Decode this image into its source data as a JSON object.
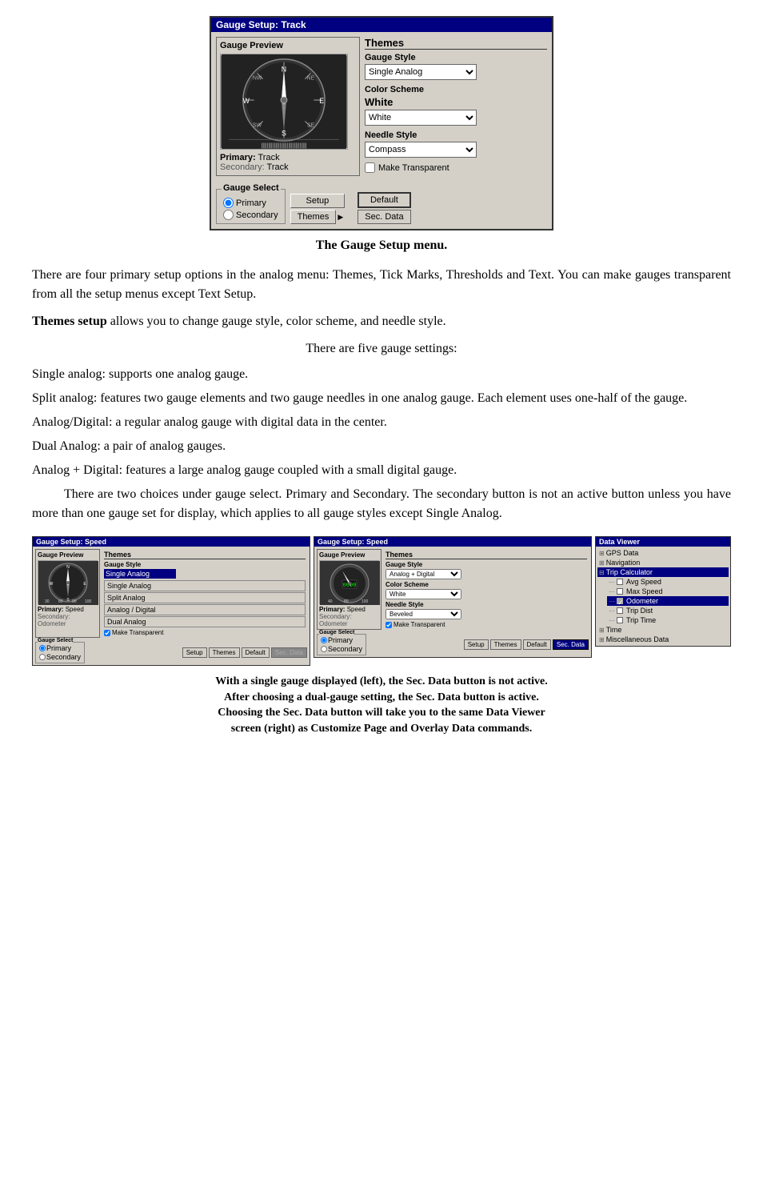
{
  "main_dialog": {
    "title": "Gauge Setup: Track",
    "gauge_preview": {
      "section_title": "Gauge Preview",
      "primary_label": "Primary:",
      "primary_value": "Track",
      "secondary_label": "Secondary:",
      "secondary_value": "Track"
    },
    "themes": {
      "section_title": "Themes",
      "gauge_style_label": "Gauge Style",
      "gauge_style_subtext": "",
      "gauge_style_selected": "Single Analog",
      "color_scheme_label": "Color Scheme",
      "color_scheme_value": "White",
      "needle_style_label": "Needle Style",
      "needle_style_selected": "Compass",
      "make_transparent_label": "Make Transparent"
    },
    "gauge_select": {
      "title": "Gauge Select",
      "primary_label": "Primary",
      "secondary_label": "Secondary",
      "default_btn": "Default",
      "setup_btn": "Setup",
      "themes_btn": "Themes",
      "sec_data_btn": "Sec. Data"
    }
  },
  "figure_caption": "The Gauge Setup menu.",
  "paragraphs": [
    "There are four primary setup options in the analog menu: Themes, Tick Marks, Thresholds and Text. You can make gauges transparent from all the setup menus except Text Setup.",
    "Themes setup allows you to change gauge style, color scheme, and needle style.",
    "There are five gauge settings:",
    "Single analog: supports one analog gauge.",
    "Split analog: features two gauge elements and two gauge needles in one analog gauge. Each element uses one-half of the gauge.",
    "Analog/Digital: a regular analog gauge with digital data in the center.",
    "Dual Analog: a pair of analog gauges.",
    "Analog + Digital: features a large analog gauge coupled with a small digital gauge.",
    "There are two choices under gauge select. Primary and Secondary. The secondary button is not an active button unless you have more than one gauge set for display, which applies to all gauge styles except Single Analog."
  ],
  "themes_setup_bold": "Themes setup",
  "small_dialogs": {
    "left": {
      "title": "Gauge Setup: Speed",
      "preview_title": "Gauge Preview",
      "themes_title": "Themes",
      "gauge_style_label": "Gauge Style",
      "selected_style": "Single Analog",
      "menu_items": [
        "Single Analog",
        "Split Analog",
        "Analog / Digital",
        "Dual Analog"
      ],
      "make_transparent": "Make Transparent",
      "primary_label": "Primary:",
      "primary_value": "Speed",
      "secondary_label": "Secondary:",
      "secondary_value": "Odometer",
      "gauge_select_title": "Gauge Select",
      "primary_radio": "Primary",
      "secondary_radio": "Secondary",
      "setup_btn": "Setup",
      "themes_btn": "Themes",
      "default_btn": "Default",
      "sec_data_btn": "Sec. Data"
    },
    "right": {
      "title": "Gauge Setup: Speed",
      "preview_title": "Gauge Preview",
      "themes_title": "Themes",
      "gauge_style_label": "Gauge Style",
      "selected_style": "Analog + Digital",
      "color_scheme_label": "Color Scheme",
      "color_scheme_value": "White",
      "needle_style_label": "Needle Style",
      "needle_style_value": "Beveled",
      "make_transparent": "Make Transparent",
      "primary_label": "Primary:",
      "primary_value": "Speed",
      "secondary_label": "Secondary:",
      "secondary_value": "Odometer",
      "gauge_select_title": "Gauge Select",
      "primary_radio": "Primary",
      "secondary_radio": "Secondary",
      "setup_btn": "Setup",
      "themes_btn": "Themes",
      "default_btn": "Default",
      "sec_data_btn": "Sec. Data"
    },
    "data_viewer": {
      "title": "Data Viewer",
      "items": [
        {
          "label": "GPS Data",
          "icon": "+",
          "indent": 0
        },
        {
          "label": "Navigation",
          "icon": "+",
          "indent": 0
        },
        {
          "label": "Trip Calculator",
          "icon": "-",
          "indent": 0,
          "selected": true
        },
        {
          "label": "Avg Speed",
          "icon": "□",
          "indent": 1
        },
        {
          "label": "Max Speed",
          "icon": "□",
          "indent": 1
        },
        {
          "label": "Odometer",
          "icon": "☑",
          "indent": 1,
          "selected": true
        },
        {
          "label": "Trip Dist",
          "icon": "□",
          "indent": 1
        },
        {
          "label": "Trip Time",
          "icon": "□",
          "indent": 1
        },
        {
          "label": "Time",
          "icon": "+",
          "indent": 0
        },
        {
          "label": "Miscellaneous Data",
          "icon": "+",
          "indent": 0
        }
      ]
    }
  },
  "bottom_caption": {
    "line1": "With a single gauge displayed (left), the Sec. Data button is not active.",
    "line2": "After choosing a dual-gauge setting, the Sec. Data button is active.",
    "line3": "Choosing the Sec. Data button will take you to the same Data Viewer",
    "line4": "screen (right) as Customize Page and Overlay Data commands."
  }
}
